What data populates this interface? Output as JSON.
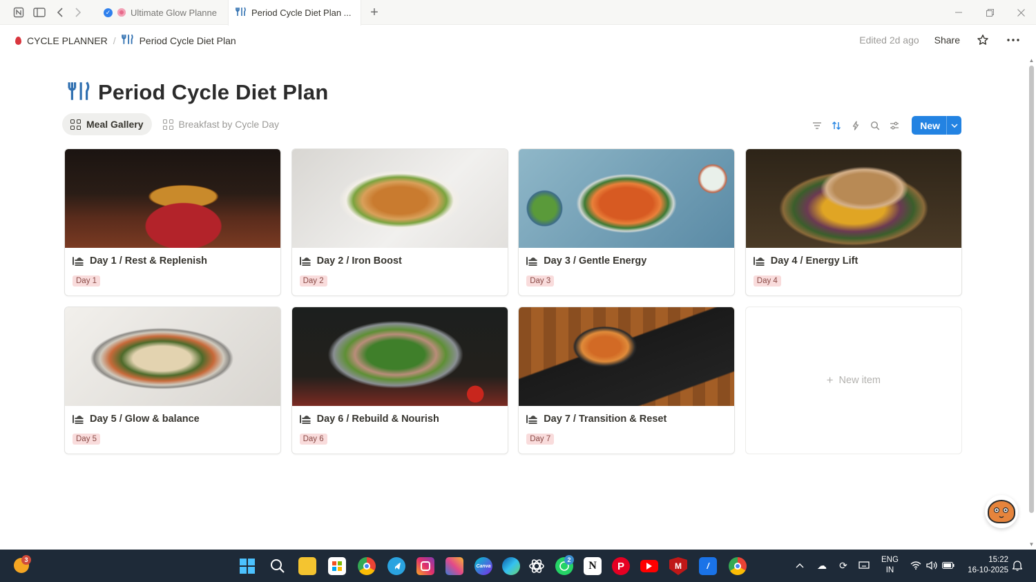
{
  "browser": {
    "tabs": [
      {
        "label": "Ultimate Glow Planne",
        "active": false
      },
      {
        "label": "Period Cycle Diet Plan ...",
        "active": true
      }
    ]
  },
  "breadcrumb": {
    "root": "CYCLE PLANNER",
    "separator": "/",
    "current": "Period Cycle Diet Plan",
    "edited": "Edited 2d ago",
    "share": "Share"
  },
  "page": {
    "title": "Period Cycle Diet Plan",
    "views": [
      {
        "label": "Meal Gallery",
        "active": true
      },
      {
        "label": "Breakfast by Cycle Day",
        "active": false
      }
    ],
    "new_label": "New"
  },
  "cards": [
    {
      "title": "Day 1 / Rest & Replenish",
      "tag": "Day 1",
      "image": "ramen-bowl"
    },
    {
      "title": "Day 2 / Iron Boost",
      "tag": "Day 2",
      "image": "chickpea-salad"
    },
    {
      "title": "Day 3 / Gentle Energy",
      "tag": "Day 3",
      "image": "sweet-potato-bowl"
    },
    {
      "title": "Day 4 / Energy Lift",
      "tag": "Day 4",
      "image": "roast-vegetables"
    },
    {
      "title": "Day 5 / Glow & balance",
      "tag": "Day 5",
      "image": "grain-bowl"
    },
    {
      "title": "Day 6 / Rebuild & Nourish",
      "tag": "Day 6",
      "image": "tuna-salad"
    },
    {
      "title": "Day 7 / Transition & Reset",
      "tag": "Day 7",
      "image": "curry-rice-tray"
    }
  ],
  "new_item_label": "New item",
  "taskbar": {
    "weather_badge": "3",
    "whatsapp_badge": "2",
    "language": "ENG",
    "region": "IN",
    "time": "15:22",
    "date": "16-10-2025"
  },
  "colors": {
    "accent": "#2383e2",
    "tag_bg": "#f9dcdc",
    "taskbar": "#1e2a38"
  }
}
